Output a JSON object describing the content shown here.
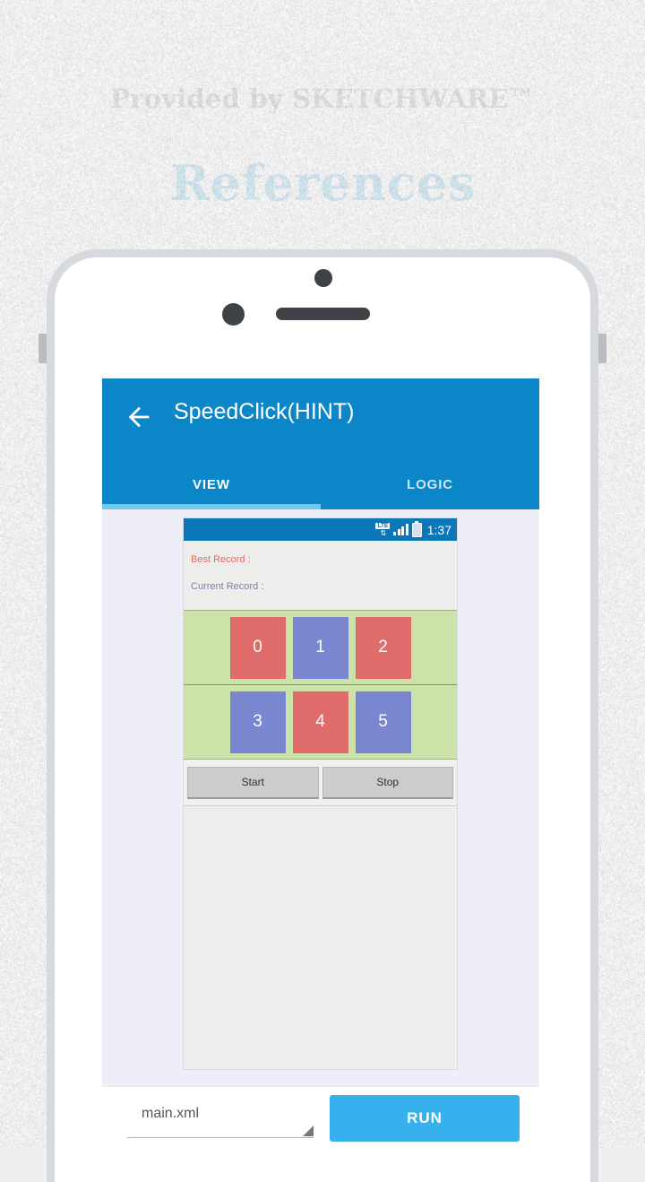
{
  "poster": {
    "provided_by": "Provided by SKETCHWARE™",
    "title": "References"
  },
  "app": {
    "back_icon": "back-arrow-icon",
    "title": "SpeedClick(HINT)",
    "tabs": [
      {
        "label": "VIEW",
        "active": true
      },
      {
        "label": "LOGIC",
        "active": false
      }
    ]
  },
  "preview": {
    "status_bar": {
      "lte_badge": "LTE",
      "lte_arrows": "⇅",
      "signal_icon": "signal-bars-icon",
      "battery_icon": "battery-icon",
      "time": "1:37"
    },
    "labels": {
      "best_record": "Best Record :",
      "current_record": "Current Record :"
    },
    "grid": {
      "rows": [
        [
          {
            "label": "0",
            "color": "red"
          },
          {
            "label": "1",
            "color": "blue"
          },
          {
            "label": "2",
            "color": "red"
          }
        ],
        [
          {
            "label": "3",
            "color": "blue"
          },
          {
            "label": "4",
            "color": "red"
          },
          {
            "label": "5",
            "color": "blue"
          }
        ]
      ]
    },
    "controls": {
      "start": "Start",
      "stop": "Stop"
    }
  },
  "bottom_bar": {
    "file_selector": {
      "value": "main.xml",
      "caret_icon": "dropdown-caret-icon"
    },
    "run_button": "RUN"
  },
  "colors": {
    "appbar_blue": "#0b86c8",
    "tab_indicator": "#6ecaf0",
    "run_blue": "#37b0ee",
    "title_blue": "#1e90d2",
    "heading_gray": "#6b6b6b",
    "grid_green": "#cbe3a9",
    "btn_red": "#e06b6b",
    "btn_blue": "#7b86d0",
    "best_record_red": "#e8695e",
    "current_record_blue": "#7b7fb0",
    "canvas_lavender": "#eeeef8",
    "mock_body_gray": "#ededeb"
  }
}
